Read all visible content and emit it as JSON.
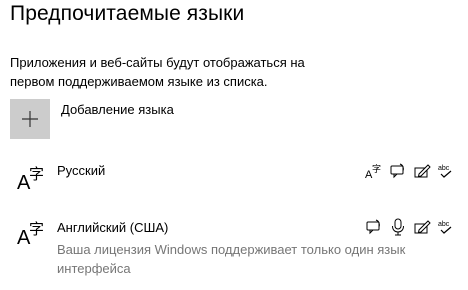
{
  "section": {
    "title": "Предпочитаемые языки",
    "description": "Приложения и веб-сайты будут отображаться на первом поддерживаемом языке из списка."
  },
  "add_language": {
    "label": "Добавление языка",
    "icon": "plus-icon"
  },
  "languages": [
    {
      "name": "Русский",
      "icon": "language-icon",
      "features": [
        "display-language-icon",
        "speech-icon",
        "handwriting-icon",
        "spellcheck-icon"
      ]
    },
    {
      "name": "Английский (США)",
      "note": "Ваша лицензия Windows поддерживает только один язык интерфейса",
      "icon": "language-icon",
      "features": [
        "speech-icon",
        "microphone-icon",
        "handwriting-icon",
        "spellcheck-icon"
      ]
    }
  ],
  "colors": {
    "add_box": "#cccccc",
    "secondary_text": "#767676"
  }
}
